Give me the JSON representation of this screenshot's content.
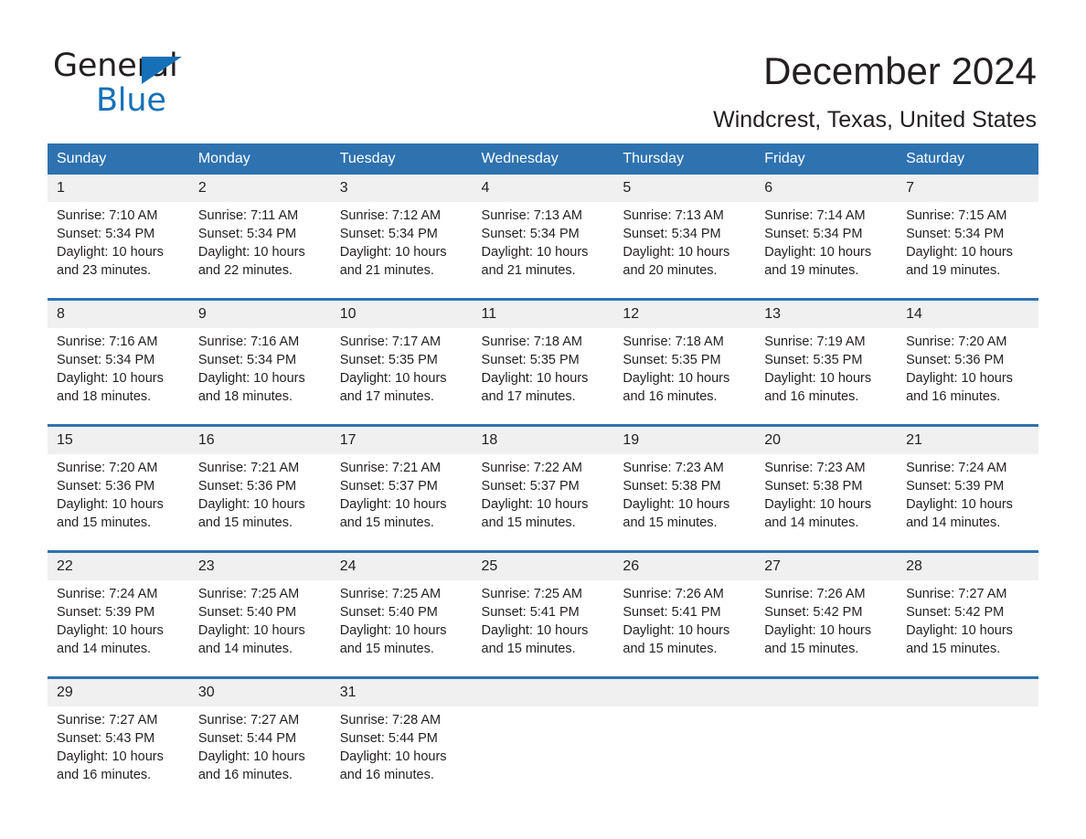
{
  "brand": {
    "name_part1": "General",
    "name_part2": "Blue"
  },
  "header": {
    "title": "December 2024",
    "subtitle": "Windcrest, Texas, United States"
  },
  "colors": {
    "header_blue": "#2e72b0",
    "logo_blue": "#1570b8",
    "daynum_band": "#f0f0f0",
    "text": "#231f20"
  },
  "weekday_headers": [
    "Sunday",
    "Monday",
    "Tuesday",
    "Wednesday",
    "Thursday",
    "Friday",
    "Saturday"
  ],
  "labels": {
    "sunrise_prefix": "Sunrise:",
    "sunset_prefix": "Sunset:",
    "daylight_prefix": "Daylight:"
  },
  "weeks": [
    {
      "days": [
        {
          "num": "1",
          "sunrise": "Sunrise: 7:10 AM",
          "sunset": "Sunset: 5:34 PM",
          "daylight_line1": "Daylight: 10 hours",
          "daylight_line2": "and 23 minutes."
        },
        {
          "num": "2",
          "sunrise": "Sunrise: 7:11 AM",
          "sunset": "Sunset: 5:34 PM",
          "daylight_line1": "Daylight: 10 hours",
          "daylight_line2": "and 22 minutes."
        },
        {
          "num": "3",
          "sunrise": "Sunrise: 7:12 AM",
          "sunset": "Sunset: 5:34 PM",
          "daylight_line1": "Daylight: 10 hours",
          "daylight_line2": "and 21 minutes."
        },
        {
          "num": "4",
          "sunrise": "Sunrise: 7:13 AM",
          "sunset": "Sunset: 5:34 PM",
          "daylight_line1": "Daylight: 10 hours",
          "daylight_line2": "and 21 minutes."
        },
        {
          "num": "5",
          "sunrise": "Sunrise: 7:13 AM",
          "sunset": "Sunset: 5:34 PM",
          "daylight_line1": "Daylight: 10 hours",
          "daylight_line2": "and 20 minutes."
        },
        {
          "num": "6",
          "sunrise": "Sunrise: 7:14 AM",
          "sunset": "Sunset: 5:34 PM",
          "daylight_line1": "Daylight: 10 hours",
          "daylight_line2": "and 19 minutes."
        },
        {
          "num": "7",
          "sunrise": "Sunrise: 7:15 AM",
          "sunset": "Sunset: 5:34 PM",
          "daylight_line1": "Daylight: 10 hours",
          "daylight_line2": "and 19 minutes."
        }
      ]
    },
    {
      "days": [
        {
          "num": "8",
          "sunrise": "Sunrise: 7:16 AM",
          "sunset": "Sunset: 5:34 PM",
          "daylight_line1": "Daylight: 10 hours",
          "daylight_line2": "and 18 minutes."
        },
        {
          "num": "9",
          "sunrise": "Sunrise: 7:16 AM",
          "sunset": "Sunset: 5:34 PM",
          "daylight_line1": "Daylight: 10 hours",
          "daylight_line2": "and 18 minutes."
        },
        {
          "num": "10",
          "sunrise": "Sunrise: 7:17 AM",
          "sunset": "Sunset: 5:35 PM",
          "daylight_line1": "Daylight: 10 hours",
          "daylight_line2": "and 17 minutes."
        },
        {
          "num": "11",
          "sunrise": "Sunrise: 7:18 AM",
          "sunset": "Sunset: 5:35 PM",
          "daylight_line1": "Daylight: 10 hours",
          "daylight_line2": "and 17 minutes."
        },
        {
          "num": "12",
          "sunrise": "Sunrise: 7:18 AM",
          "sunset": "Sunset: 5:35 PM",
          "daylight_line1": "Daylight: 10 hours",
          "daylight_line2": "and 16 minutes."
        },
        {
          "num": "13",
          "sunrise": "Sunrise: 7:19 AM",
          "sunset": "Sunset: 5:35 PM",
          "daylight_line1": "Daylight: 10 hours",
          "daylight_line2": "and 16 minutes."
        },
        {
          "num": "14",
          "sunrise": "Sunrise: 7:20 AM",
          "sunset": "Sunset: 5:36 PM",
          "daylight_line1": "Daylight: 10 hours",
          "daylight_line2": "and 16 minutes."
        }
      ]
    },
    {
      "days": [
        {
          "num": "15",
          "sunrise": "Sunrise: 7:20 AM",
          "sunset": "Sunset: 5:36 PM",
          "daylight_line1": "Daylight: 10 hours",
          "daylight_line2": "and 15 minutes."
        },
        {
          "num": "16",
          "sunrise": "Sunrise: 7:21 AM",
          "sunset": "Sunset: 5:36 PM",
          "daylight_line1": "Daylight: 10 hours",
          "daylight_line2": "and 15 minutes."
        },
        {
          "num": "17",
          "sunrise": "Sunrise: 7:21 AM",
          "sunset": "Sunset: 5:37 PM",
          "daylight_line1": "Daylight: 10 hours",
          "daylight_line2": "and 15 minutes."
        },
        {
          "num": "18",
          "sunrise": "Sunrise: 7:22 AM",
          "sunset": "Sunset: 5:37 PM",
          "daylight_line1": "Daylight: 10 hours",
          "daylight_line2": "and 15 minutes."
        },
        {
          "num": "19",
          "sunrise": "Sunrise: 7:23 AM",
          "sunset": "Sunset: 5:38 PM",
          "daylight_line1": "Daylight: 10 hours",
          "daylight_line2": "and 15 minutes."
        },
        {
          "num": "20",
          "sunrise": "Sunrise: 7:23 AM",
          "sunset": "Sunset: 5:38 PM",
          "daylight_line1": "Daylight: 10 hours",
          "daylight_line2": "and 14 minutes."
        },
        {
          "num": "21",
          "sunrise": "Sunrise: 7:24 AM",
          "sunset": "Sunset: 5:39 PM",
          "daylight_line1": "Daylight: 10 hours",
          "daylight_line2": "and 14 minutes."
        }
      ]
    },
    {
      "days": [
        {
          "num": "22",
          "sunrise": "Sunrise: 7:24 AM",
          "sunset": "Sunset: 5:39 PM",
          "daylight_line1": "Daylight: 10 hours",
          "daylight_line2": "and 14 minutes."
        },
        {
          "num": "23",
          "sunrise": "Sunrise: 7:25 AM",
          "sunset": "Sunset: 5:40 PM",
          "daylight_line1": "Daylight: 10 hours",
          "daylight_line2": "and 14 minutes."
        },
        {
          "num": "24",
          "sunrise": "Sunrise: 7:25 AM",
          "sunset": "Sunset: 5:40 PM",
          "daylight_line1": "Daylight: 10 hours",
          "daylight_line2": "and 15 minutes."
        },
        {
          "num": "25",
          "sunrise": "Sunrise: 7:25 AM",
          "sunset": "Sunset: 5:41 PM",
          "daylight_line1": "Daylight: 10 hours",
          "daylight_line2": "and 15 minutes."
        },
        {
          "num": "26",
          "sunrise": "Sunrise: 7:26 AM",
          "sunset": "Sunset: 5:41 PM",
          "daylight_line1": "Daylight: 10 hours",
          "daylight_line2": "and 15 minutes."
        },
        {
          "num": "27",
          "sunrise": "Sunrise: 7:26 AM",
          "sunset": "Sunset: 5:42 PM",
          "daylight_line1": "Daylight: 10 hours",
          "daylight_line2": "and 15 minutes."
        },
        {
          "num": "28",
          "sunrise": "Sunrise: 7:27 AM",
          "sunset": "Sunset: 5:42 PM",
          "daylight_line1": "Daylight: 10 hours",
          "daylight_line2": "and 15 minutes."
        }
      ]
    },
    {
      "days": [
        {
          "num": "29",
          "sunrise": "Sunrise: 7:27 AM",
          "sunset": "Sunset: 5:43 PM",
          "daylight_line1": "Daylight: 10 hours",
          "daylight_line2": "and 16 minutes."
        },
        {
          "num": "30",
          "sunrise": "Sunrise: 7:27 AM",
          "sunset": "Sunset: 5:44 PM",
          "daylight_line1": "Daylight: 10 hours",
          "daylight_line2": "and 16 minutes."
        },
        {
          "num": "31",
          "sunrise": "Sunrise: 7:28 AM",
          "sunset": "Sunset: 5:44 PM",
          "daylight_line1": "Daylight: 10 hours",
          "daylight_line2": "and 16 minutes."
        },
        {
          "num": "",
          "sunrise": "",
          "sunset": "",
          "daylight_line1": "",
          "daylight_line2": ""
        },
        {
          "num": "",
          "sunrise": "",
          "sunset": "",
          "daylight_line1": "",
          "daylight_line2": ""
        },
        {
          "num": "",
          "sunrise": "",
          "sunset": "",
          "daylight_line1": "",
          "daylight_line2": ""
        },
        {
          "num": "",
          "sunrise": "",
          "sunset": "",
          "daylight_line1": "",
          "daylight_line2": ""
        }
      ]
    }
  ]
}
